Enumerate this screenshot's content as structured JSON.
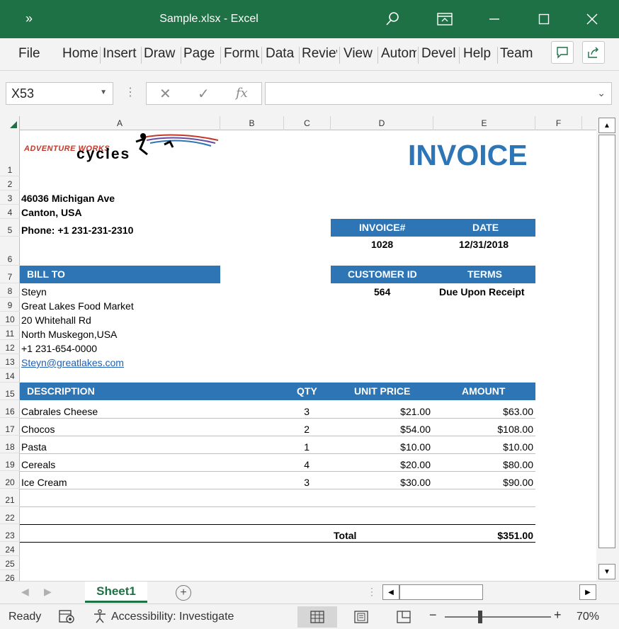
{
  "window": {
    "title": "Sample.xlsx  -  Excel"
  },
  "ribbon": {
    "tabs": [
      "File",
      "Home",
      "Insert",
      "Draw",
      "Page",
      "Formu",
      "Data",
      "Review",
      "View",
      "Autom",
      "Devel",
      "Help",
      "Team"
    ]
  },
  "formula_bar": {
    "name_box": "X53",
    "fx_label": "fx",
    "content": ""
  },
  "columns": [
    "A",
    "B",
    "C",
    "D",
    "E",
    "F"
  ],
  "rows": [
    "1",
    "2",
    "3",
    "4",
    "5",
    "6",
    "7",
    "8",
    "9",
    "10",
    "11",
    "12",
    "13",
    "14",
    "15",
    "16",
    "17",
    "18",
    "19",
    "20",
    "21",
    "22",
    "23",
    "24",
    "25",
    "26"
  ],
  "logo": {
    "line1": "ADVENTURE WORKS",
    "line2": "cycles"
  },
  "invoice": {
    "title": "INVOICE",
    "address_line1": "46036 Michigan Ave",
    "address_line2": "Canton, USA",
    "phone": "Phone: +1 231-231-2310",
    "invoice_no_label": "INVOICE#",
    "date_label": "DATE",
    "invoice_no": "1028",
    "date": "12/31/2018",
    "customer_id_label": "CUSTOMER ID",
    "terms_label": "TERMS",
    "customer_id": "564",
    "terms": "Due Upon Receipt",
    "bill_to_label": "BILL TO",
    "bill_to": {
      "name": "Steyn",
      "company": "Great Lakes Food Market",
      "street": "20 Whitehall Rd",
      "city": "North Muskegon,USA",
      "phone": "+1 231-654-0000",
      "email": "Steyn@greatlakes.com"
    },
    "headers": {
      "description": "DESCRIPTION",
      "qty": "QTY",
      "unit_price": "UNIT PRICE",
      "amount": "AMOUNT"
    },
    "items": [
      {
        "description": "Cabrales Cheese",
        "qty": "3",
        "unit_price": "$21.00",
        "amount": "$63.00"
      },
      {
        "description": "Chocos",
        "qty": "2",
        "unit_price": "$54.00",
        "amount": "$108.00"
      },
      {
        "description": "Pasta",
        "qty": "1",
        "unit_price": "$10.00",
        "amount": "$10.00"
      },
      {
        "description": "Cereals",
        "qty": "4",
        "unit_price": "$20.00",
        "amount": "$80.00"
      },
      {
        "description": "Ice Cream",
        "qty": "3",
        "unit_price": "$30.00",
        "amount": "$90.00"
      }
    ],
    "total_label": "Total",
    "total": "$351.00"
  },
  "sheet_tabs": {
    "active": "Sheet1"
  },
  "status": {
    "ready": "Ready",
    "accessibility": "Accessibility: Investigate",
    "zoom": "70%"
  },
  "colors": {
    "excel_green": "#1e7145",
    "accent_blue": "#2e75b6"
  }
}
